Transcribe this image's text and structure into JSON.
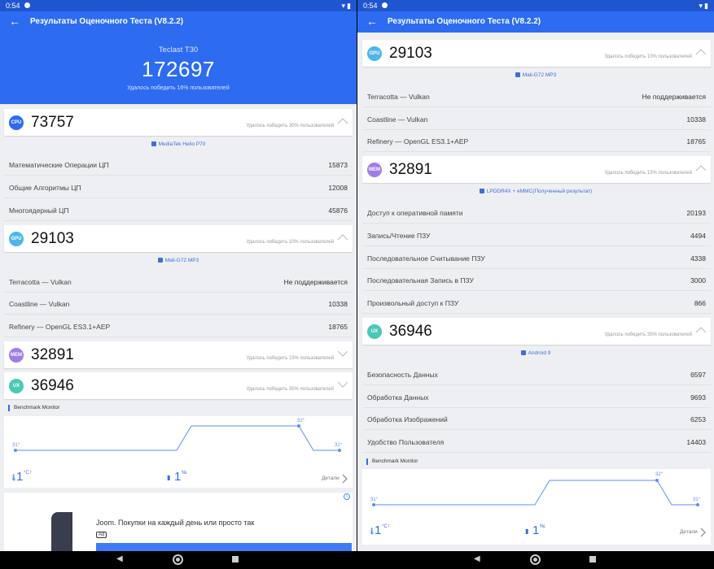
{
  "status": {
    "time": "0:54"
  },
  "app": {
    "back_icon": "arrow-left-icon",
    "title": "Результаты Оценочного Теста (V8.2.2)"
  },
  "summary": {
    "device": "Teclast T30",
    "total": "172697",
    "beat": "Удалось победить 16% пользователей"
  },
  "cpu": {
    "badge": "CPU",
    "score": "73757",
    "beat": "Удалось победить 30% пользователей",
    "chip": "MediaTek Helio P70",
    "rows": [
      {
        "name": "Математические Операции ЦП",
        "value": "15873"
      },
      {
        "name": "Общие Алгоритмы ЦП",
        "value": "12008"
      },
      {
        "name": "Многоядерный ЦП",
        "value": "45876"
      }
    ]
  },
  "gpu": {
    "badge": "GPU",
    "score": "29103",
    "beat": "Удалось победить 10% пользователей",
    "chip": "Mali-G72 MP3",
    "rows": [
      {
        "name": "Terracotta — Vulkan",
        "value": "Не поддерживается"
      },
      {
        "name": "Coastline — Vulkan",
        "value": "10338"
      },
      {
        "name": "Refinery — OpenGL ES3.1+AEP",
        "value": "18765"
      }
    ]
  },
  "mem": {
    "badge": "MEM",
    "score": "32891",
    "beat": "Удалось победить 15% пользователей",
    "chip": "LPDDR4X + eMMC(Полученный результат)",
    "rows": [
      {
        "name": "Доступ к оперативной памяти",
        "value": "20193"
      },
      {
        "name": "Запись/Чтение ПЗУ",
        "value": "4494"
      },
      {
        "name": "Последовательное Считывание ПЗУ",
        "value": "4338"
      },
      {
        "name": "Последовательная Запись в ПЗУ",
        "value": "3000"
      },
      {
        "name": "Произвольный доступ к ПЗУ",
        "value": "866"
      }
    ]
  },
  "ux": {
    "badge": "UX",
    "score": "36946",
    "beat": "Удалось победить 35% пользователей",
    "chip": "Android 9",
    "rows": [
      {
        "name": "Безопасность Данных",
        "value": "6597"
      },
      {
        "name": "Обработка Данных",
        "value": "9693"
      },
      {
        "name": "Обработка Изображений",
        "value": "6253"
      },
      {
        "name": "Удобство Пользователя",
        "value": "14403"
      }
    ]
  },
  "monitor": {
    "title": "Benchmark Monitor",
    "label_start": "31°",
    "label_peak": "32°",
    "label_end": "31°",
    "temp_value": "1",
    "temp_unit": "°C",
    "temp_arrow": "↑",
    "batt_value": "1",
    "batt_unit": "%",
    "batt_arrow": "↓",
    "details": "Детали"
  },
  "ad": {
    "text": "Joom. Покупки на каждый день или просто так",
    "tag": "Ad",
    "info": "i"
  },
  "colors": {
    "primary": "#2d6cf0",
    "cpu": "#2d6cf0",
    "gpu": "#4fb6ea",
    "mem": "#a07ce6",
    "ux": "#4cc9b6"
  }
}
